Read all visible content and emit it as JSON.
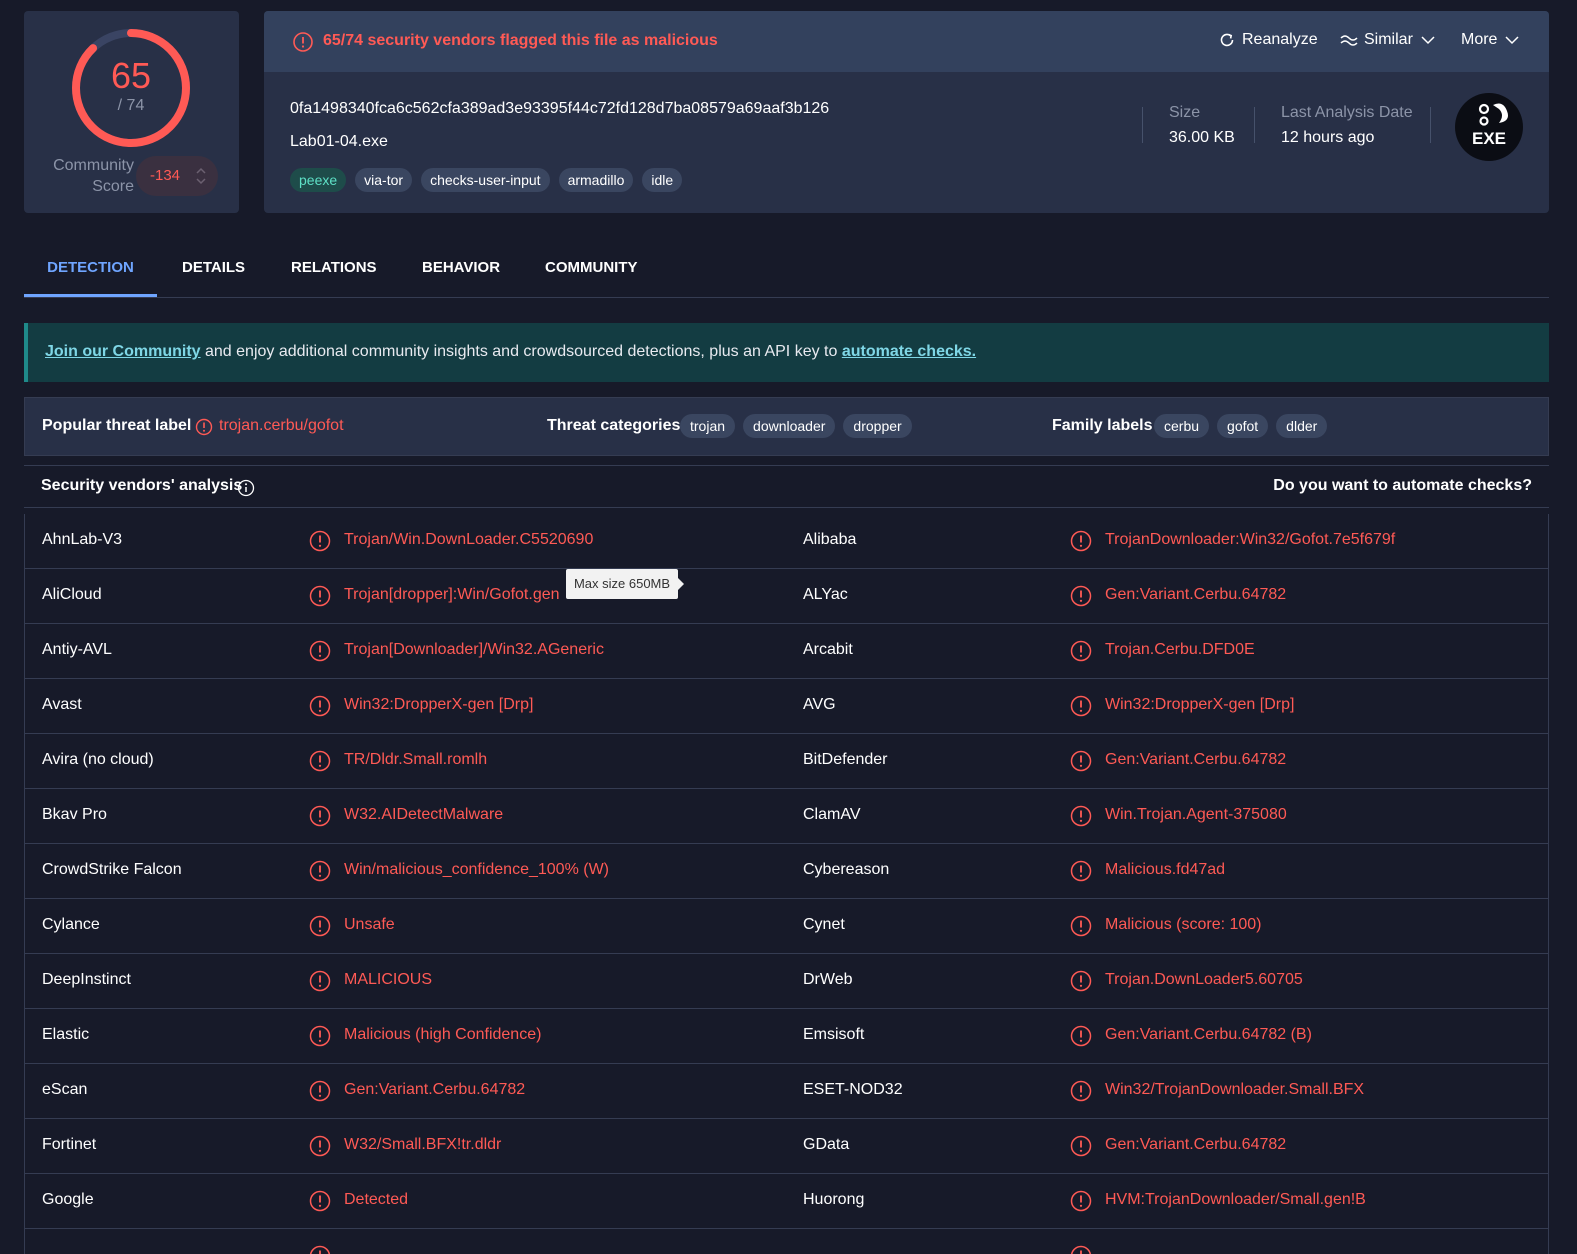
{
  "score": {
    "detections": "65",
    "total": "/ 74",
    "community_label": "Community Score",
    "community_value": "-134",
    "ring_fraction": 0.878
  },
  "alert": {
    "text": "65/74 security vendors flagged this file as malicious",
    "reanalyze": "Reanalyze",
    "similar": "Similar",
    "more": "More"
  },
  "file": {
    "hash": "0fa1498340fca6c562cfa389ad3e93395f44c72fd128d7ba08579a69aaf3b126",
    "name": "Lab01-04.exe",
    "tags": [
      "peexe",
      "via-tor",
      "checks-user-input",
      "armadillo",
      "idle"
    ],
    "size_label": "Size",
    "size": "36.00 KB",
    "date_label": "Last Analysis Date",
    "date": "12 hours ago",
    "type_badge": "EXE"
  },
  "tabs": [
    "DETECTION",
    "DETAILS",
    "RELATIONS",
    "BEHAVIOR",
    "COMMUNITY"
  ],
  "banner": {
    "link1": "Join our Community",
    "middle": " and enjoy additional community insights and crowdsourced detections, plus an API key to ",
    "link2": "automate checks."
  },
  "threat": {
    "popular_label": "Popular threat label",
    "popular_value": "trojan.cerbu/gofot",
    "categories_label": "Threat categories",
    "categories": [
      "trojan",
      "downloader",
      "dropper"
    ],
    "family_label": "Family labels",
    "families": [
      "cerbu",
      "gofot",
      "dlder"
    ]
  },
  "vendors_header": {
    "title": "Security vendors' analysis",
    "automate": "Do you want to automate checks?"
  },
  "tooltip": "Max size 650MB",
  "colors": {
    "malicious": "#ff5a55",
    "accent": "#6fa5ff",
    "card": "#283047",
    "background": "#171a29"
  },
  "rows": [
    {
      "v1": "AhnLab-V3",
      "r1": "Trojan/Win.DownLoader.C5520690",
      "v2": "Alibaba",
      "r2": "TrojanDownloader:Win32/Gofot.7e5f679f"
    },
    {
      "v1": "AliCloud",
      "r1": "Trojan[dropper]:Win/Gofot.gen",
      "v2": "ALYac",
      "r2": "Gen:Variant.Cerbu.64782"
    },
    {
      "v1": "Antiy-AVL",
      "r1": "Trojan[Downloader]/Win32.AGeneric",
      "v2": "Arcabit",
      "r2": "Trojan.Cerbu.DFD0E"
    },
    {
      "v1": "Avast",
      "r1": "Win32:DropperX-gen [Drp]",
      "v2": "AVG",
      "r2": "Win32:DropperX-gen [Drp]"
    },
    {
      "v1": "Avira (no cloud)",
      "r1": "TR/Dldr.Small.romlh",
      "v2": "BitDefender",
      "r2": "Gen:Variant.Cerbu.64782"
    },
    {
      "v1": "Bkav Pro",
      "r1": "W32.AIDetectMalware",
      "v2": "ClamAV",
      "r2": "Win.Trojan.Agent-375080"
    },
    {
      "v1": "CrowdStrike Falcon",
      "r1": "Win/malicious_confidence_100% (W)",
      "v2": "Cybereason",
      "r2": "Malicious.fd47ad"
    },
    {
      "v1": "Cylance",
      "r1": "Unsafe",
      "v2": "Cynet",
      "r2": "Malicious (score: 100)"
    },
    {
      "v1": "DeepInstinct",
      "r1": "MALICIOUS",
      "v2": "DrWeb",
      "r2": "Trojan.DownLoader5.60705"
    },
    {
      "v1": "Elastic",
      "r1": "Malicious (high Confidence)",
      "v2": "Emsisoft",
      "r2": "Gen:Variant.Cerbu.64782 (B)"
    },
    {
      "v1": "eScan",
      "r1": "Gen:Variant.Cerbu.64782",
      "v2": "ESET-NOD32",
      "r2": "Win32/TrojanDownloader.Small.BFX"
    },
    {
      "v1": "Fortinet",
      "r1": "W32/Small.BFX!tr.dldr",
      "v2": "GData",
      "r2": "Gen:Variant.Cerbu.64782"
    },
    {
      "v1": "Google",
      "r1": "Detected",
      "v2": "Huorong",
      "r2": "HVM:TrojanDownloader/Small.gen!B"
    }
  ]
}
